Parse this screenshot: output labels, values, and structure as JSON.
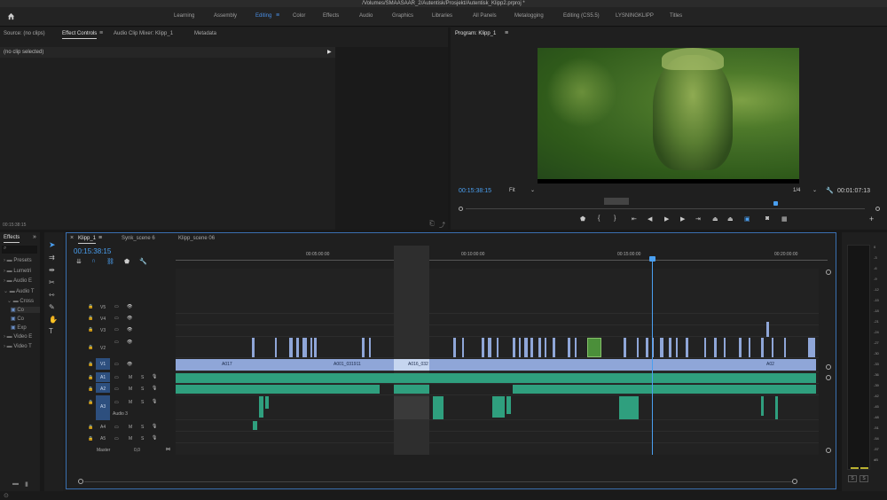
{
  "window": {
    "title": "/Volumes/SMAASAAR_2/Autentisk/Prosjekt/Autentisk_Klipp2.prproj *"
  },
  "workspaces": [
    "Learning",
    "Assembly",
    "Editing",
    "Color",
    "Effects",
    "Audio",
    "Graphics",
    "Libraries",
    "All Panels",
    "Metalogging",
    "Editing (CS5.5)",
    "LYSNINGKLIPP",
    "Titles"
  ],
  "active_workspace": "Editing",
  "source_panel": {
    "tabs": [
      "Source: (no clips)",
      "Effect Controls",
      "Audio Clip Mixer: Klipp_1",
      "Metadata"
    ],
    "active_tab": "Effect Controls",
    "empty_text": "(no clip selected)",
    "timecode": "00:15:38:15"
  },
  "program_monitor": {
    "title": "Program: Klipp_1",
    "timecode": "00:15:38:15",
    "fit": "Fit",
    "resolution": "1/4",
    "duration": "00:01:07:13"
  },
  "project_panel": {
    "tab": "Effects",
    "items": [
      "Presets",
      "Lumetri",
      "Audio E",
      "Audio T",
      "Cross",
      "Co",
      "Co",
      "Exp",
      "Video E",
      "Video T"
    ]
  },
  "timeline": {
    "tabs": [
      "Klipp_1",
      "Synk_scene 6",
      "Klipp_scene 06"
    ],
    "active_tab": "Klipp_1",
    "timecode": "00:15:38:15",
    "ruler": [
      "00:05:00:00",
      "00:10:00:00",
      "00:15:00:00",
      "00:20:00:00"
    ],
    "video_tracks": [
      "V5",
      "V4",
      "V3",
      "V2",
      "V1"
    ],
    "audio_tracks": [
      "A1",
      "A2",
      "A3",
      "A4",
      "A5"
    ],
    "audio3_name": "Audio 3",
    "master_label": "Master",
    "master_value": "0,0",
    "clip_names": [
      "A017",
      "A001_031911",
      "A016_032",
      "A02"
    ]
  },
  "meter_scale": [
    "0",
    "-3",
    "-6",
    "-9",
    "-12",
    "-15",
    "-18",
    "-21",
    "-24",
    "-27",
    "-30",
    "-33",
    "-36",
    "-39",
    "-42",
    "-45",
    "-48",
    "-51",
    "-54",
    "-57",
    "dB"
  ],
  "meter_solo": [
    "S",
    "S"
  ],
  "colors": {
    "accent": "#4a8fe6",
    "video_clip": "#8fa6d8",
    "audio_clip": "#2f9f7e"
  }
}
